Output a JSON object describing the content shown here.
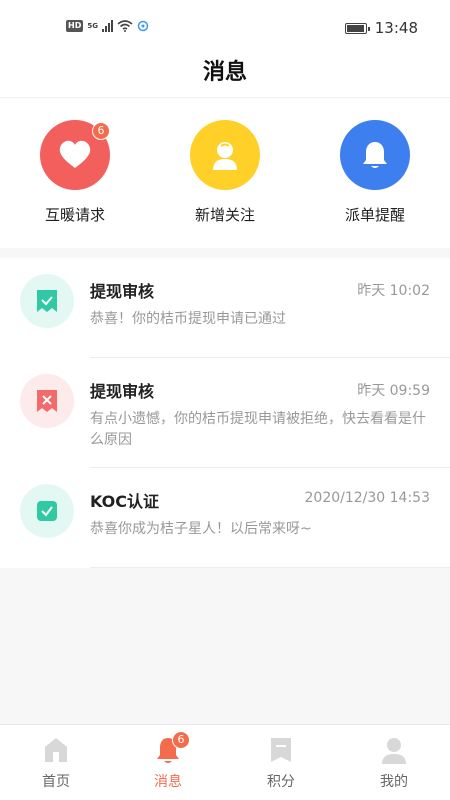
{
  "status_bar": {
    "hd": "HD",
    "network": "5G",
    "time": "13:48"
  },
  "header": {
    "title": "消息"
  },
  "quick_actions": [
    {
      "label": "互暖请求",
      "icon": "heart-icon",
      "color": "#f25f5c",
      "badge": "6"
    },
    {
      "label": "新增关注",
      "icon": "person-icon",
      "color": "#ffd028",
      "badge": ""
    },
    {
      "label": "派单提醒",
      "icon": "bell-icon",
      "color": "#3e7fef",
      "badge": ""
    }
  ],
  "messages": [
    {
      "title": "提现审核",
      "time": "昨天 10:02",
      "body": "恭喜！你的桔币提现申请已通过",
      "icon": "check-ticket-icon",
      "color": "#2fc9a4"
    },
    {
      "title": "提现审核",
      "time": "昨天 09:59",
      "body": "有点小遗憾，你的桔币提现申请被拒绝，快去看看是什么原因",
      "icon": "cross-ticket-icon",
      "color": "#f26a6a"
    },
    {
      "title": "KOC认证",
      "time": "2020/12/30 14:53",
      "body": "恭喜你成为桔子星人！以后常来呀~",
      "icon": "check-badge-icon",
      "color": "#2fc9a4"
    }
  ],
  "bottom_nav": [
    {
      "label": "首页",
      "icon": "home-icon",
      "active": false,
      "badge": ""
    },
    {
      "label": "消息",
      "icon": "bell-icon",
      "active": true,
      "badge": "6"
    },
    {
      "label": "积分",
      "icon": "points-icon",
      "active": false,
      "badge": ""
    },
    {
      "label": "我的",
      "icon": "profile-icon",
      "active": false,
      "badge": ""
    }
  ],
  "colors": {
    "accent": "#f56c4c",
    "inactive_icon": "#d8d8d8"
  }
}
